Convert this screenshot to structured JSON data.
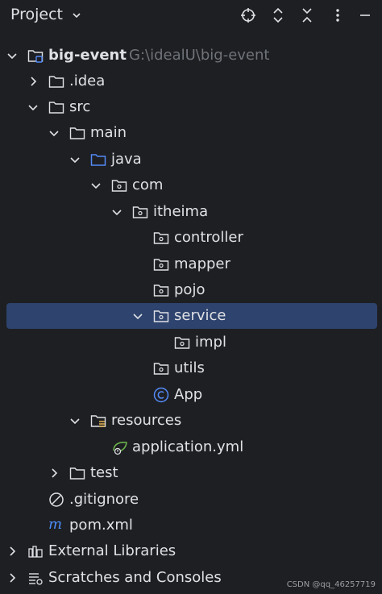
{
  "header": {
    "title": "Project",
    "icons": [
      "locate-icon",
      "expand-all-icon",
      "collapse-all-icon",
      "more-options-icon"
    ]
  },
  "tree": {
    "root_label": "big-event",
    "root_path": "G:\\idealU\\big-event",
    "idea": ".idea",
    "src": "src",
    "main": "main",
    "java": "java",
    "com": "com",
    "itheima": "itheima",
    "controller": "controller",
    "mapper": "mapper",
    "pojo": "pojo",
    "service": "service",
    "impl": "impl",
    "utils": "utils",
    "app": "App",
    "resources": "resources",
    "application_yml": "application.yml",
    "test": "test",
    "gitignore": ".gitignore",
    "pom": "pom.xml",
    "external_libraries": "External Libraries",
    "scratches": "Scratches and Consoles"
  },
  "watermark": "CSDN @qq_46257719",
  "colors": {
    "background": "#1e1f22",
    "selection": "#2e436e",
    "text": "#dfe1e5",
    "hint": "#6f737a",
    "java_folder": "#548af7",
    "maven": "#4c8cf7"
  }
}
